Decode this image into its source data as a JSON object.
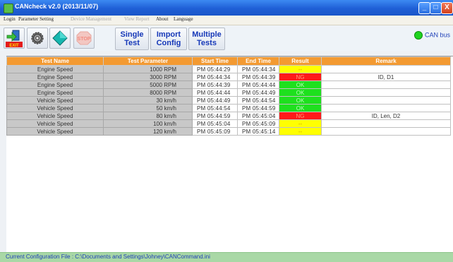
{
  "window": {
    "title": "CANcheck v2.0 (2013/11/07)",
    "controls": {
      "minimize": "_",
      "maximize": "□",
      "close": "X"
    }
  },
  "menu": [
    "Login",
    "Parameter Setting",
    "Device Management",
    "View Report",
    "About",
    "Language"
  ],
  "menu_disabled": [
    false,
    false,
    true,
    true,
    false,
    false
  ],
  "toolbar": {
    "exit_label": "EXIT",
    "stop_label": "STOP",
    "single_test": "Single Test",
    "import_config": "Import Config",
    "multiple_tests": "Multiple Tests",
    "can_status": "CAN bus"
  },
  "colors": {
    "header": "#f39a32",
    "pass": "#1ee01e",
    "fail": "#ff1a1a",
    "pending": "#ffff00",
    "status_bar": "#a9d8a6",
    "can_indicator": "#1fd41f"
  },
  "table": {
    "headers": [
      "Test Name",
      "Test Parameter",
      "Start Time",
      "End Time",
      "Result",
      "Remark"
    ],
    "rows": [
      {
        "name": "Engine Speed",
        "param": "1000 RPM",
        "start": "PM 05:44:29",
        "end": "PM 05:44:34",
        "result": "--",
        "status": "pending",
        "remark": ""
      },
      {
        "name": "Engine Speed",
        "param": "3000 RPM",
        "start": "PM 05:44:34",
        "end": "PM 05:44:39",
        "result": "NG",
        "status": "fail",
        "remark": "ID, D1"
      },
      {
        "name": "Engine Speed",
        "param": "5000 RPM",
        "start": "PM 05:44:39",
        "end": "PM 05:44:44",
        "result": "OK",
        "status": "pass",
        "remark": ""
      },
      {
        "name": "Engine Speed",
        "param": "8000 RPM",
        "start": "PM 05:44:44",
        "end": "PM 05:44:49",
        "result": "OK",
        "status": "pass",
        "remark": ""
      },
      {
        "name": "Vehicle Speed",
        "param": "30 km/h",
        "start": "PM 05:44:49",
        "end": "PM 05:44:54",
        "result": "OK",
        "status": "pass",
        "remark": ""
      },
      {
        "name": "Vehicle Speed",
        "param": "50 km/h",
        "start": "PM 05:44:54",
        "end": "PM 05:44:59",
        "result": "OK",
        "status": "pass",
        "remark": ""
      },
      {
        "name": "Vehicle Speed",
        "param": "80 km/h",
        "start": "PM 05:44:59",
        "end": "PM 05:45:04",
        "result": "NG",
        "status": "fail",
        "remark": "ID, Len, D2"
      },
      {
        "name": "Vehicle Speed",
        "param": "100 km/h",
        "start": "PM 05:45:04",
        "end": "PM 05:45:09",
        "result": "--",
        "status": "pending",
        "remark": ""
      },
      {
        "name": "Vehicle Speed",
        "param": "120 km/h",
        "start": "PM 05:45:09",
        "end": "PM 05:45:14",
        "result": "--",
        "status": "pending",
        "remark": ""
      }
    ]
  },
  "status_bar": "Current Configuration File : C:\\Documents and Settings\\Johney\\CANCommand.ini"
}
